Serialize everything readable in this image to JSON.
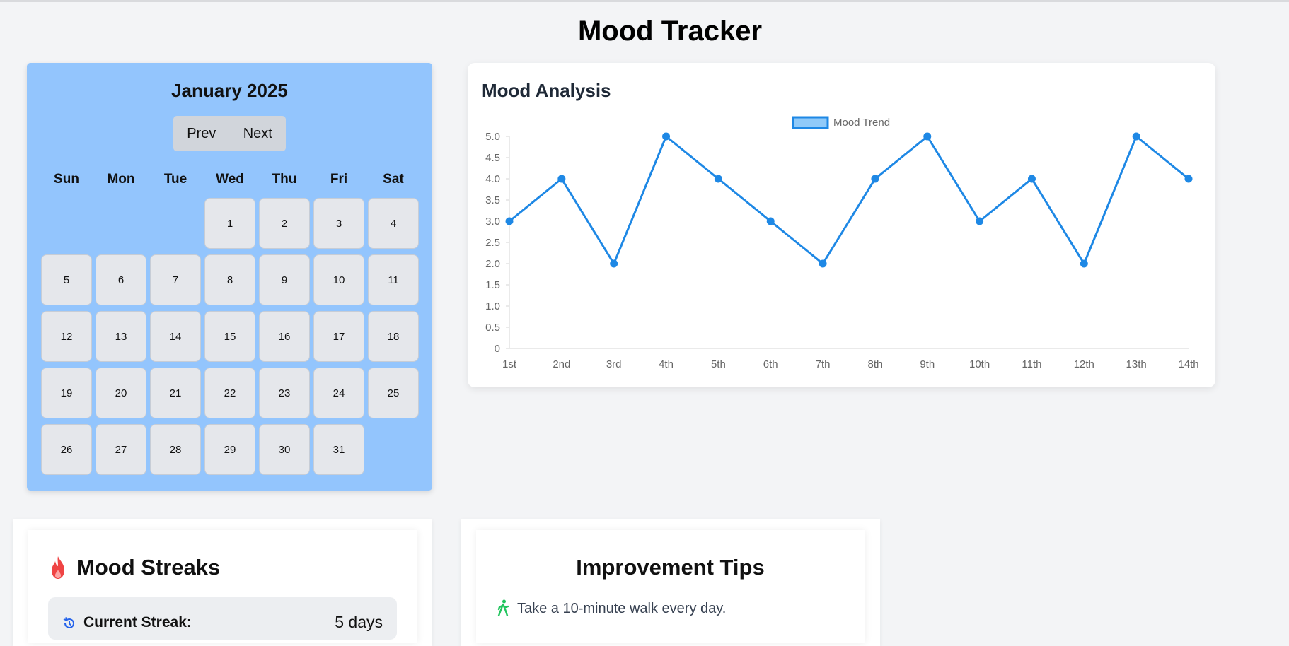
{
  "page": {
    "title": "Mood Tracker"
  },
  "calendar": {
    "month_label": "January 2025",
    "prev_label": "Prev",
    "next_label": "Next",
    "weekdays": [
      "Sun",
      "Mon",
      "Tue",
      "Wed",
      "Thu",
      "Fri",
      "Sat"
    ],
    "first_weekday_index": 3,
    "days": [
      "1",
      "2",
      "3",
      "4",
      "5",
      "6",
      "7",
      "8",
      "9",
      "10",
      "11",
      "12",
      "13",
      "14",
      "15",
      "16",
      "17",
      "18",
      "19",
      "20",
      "21",
      "22",
      "23",
      "24",
      "25",
      "26",
      "27",
      "28",
      "29",
      "30",
      "31"
    ]
  },
  "analysis": {
    "title": "Mood Analysis"
  },
  "chart_data": {
    "type": "line",
    "categories": [
      "1st",
      "2nd",
      "3rd",
      "4th",
      "5th",
      "6th",
      "7th",
      "8th",
      "9th",
      "10th",
      "11th",
      "12th",
      "13th",
      "14th"
    ],
    "series": [
      {
        "name": "Mood Trend",
        "values": [
          3,
          4,
          2,
          5,
          4,
          3,
          2,
          4,
          5,
          3,
          4,
          2,
          5,
          4
        ]
      }
    ],
    "ylim": [
      0,
      5
    ],
    "y_ticks": [
      "0",
      "0.5",
      "1.0",
      "1.5",
      "2.0",
      "2.5",
      "3.0",
      "3.5",
      "4.0",
      "4.5",
      "5.0"
    ],
    "legend_position": "top-center",
    "line_color": "#1e88e5",
    "legend_fill": "#90caf9"
  },
  "streaks": {
    "title": "Mood Streaks",
    "current_label": "Current Streak:",
    "current_value": "5 days"
  },
  "tips": {
    "title": "Improvement Tips",
    "items": [
      "Take a 10-minute walk every day."
    ]
  },
  "colors": {
    "calendar_bg": "#93c5fd",
    "day_bg": "#e5e7eb",
    "fire_icon": "#ef4444",
    "history_icon": "#2563eb",
    "walk_icon": "#22c55e"
  }
}
